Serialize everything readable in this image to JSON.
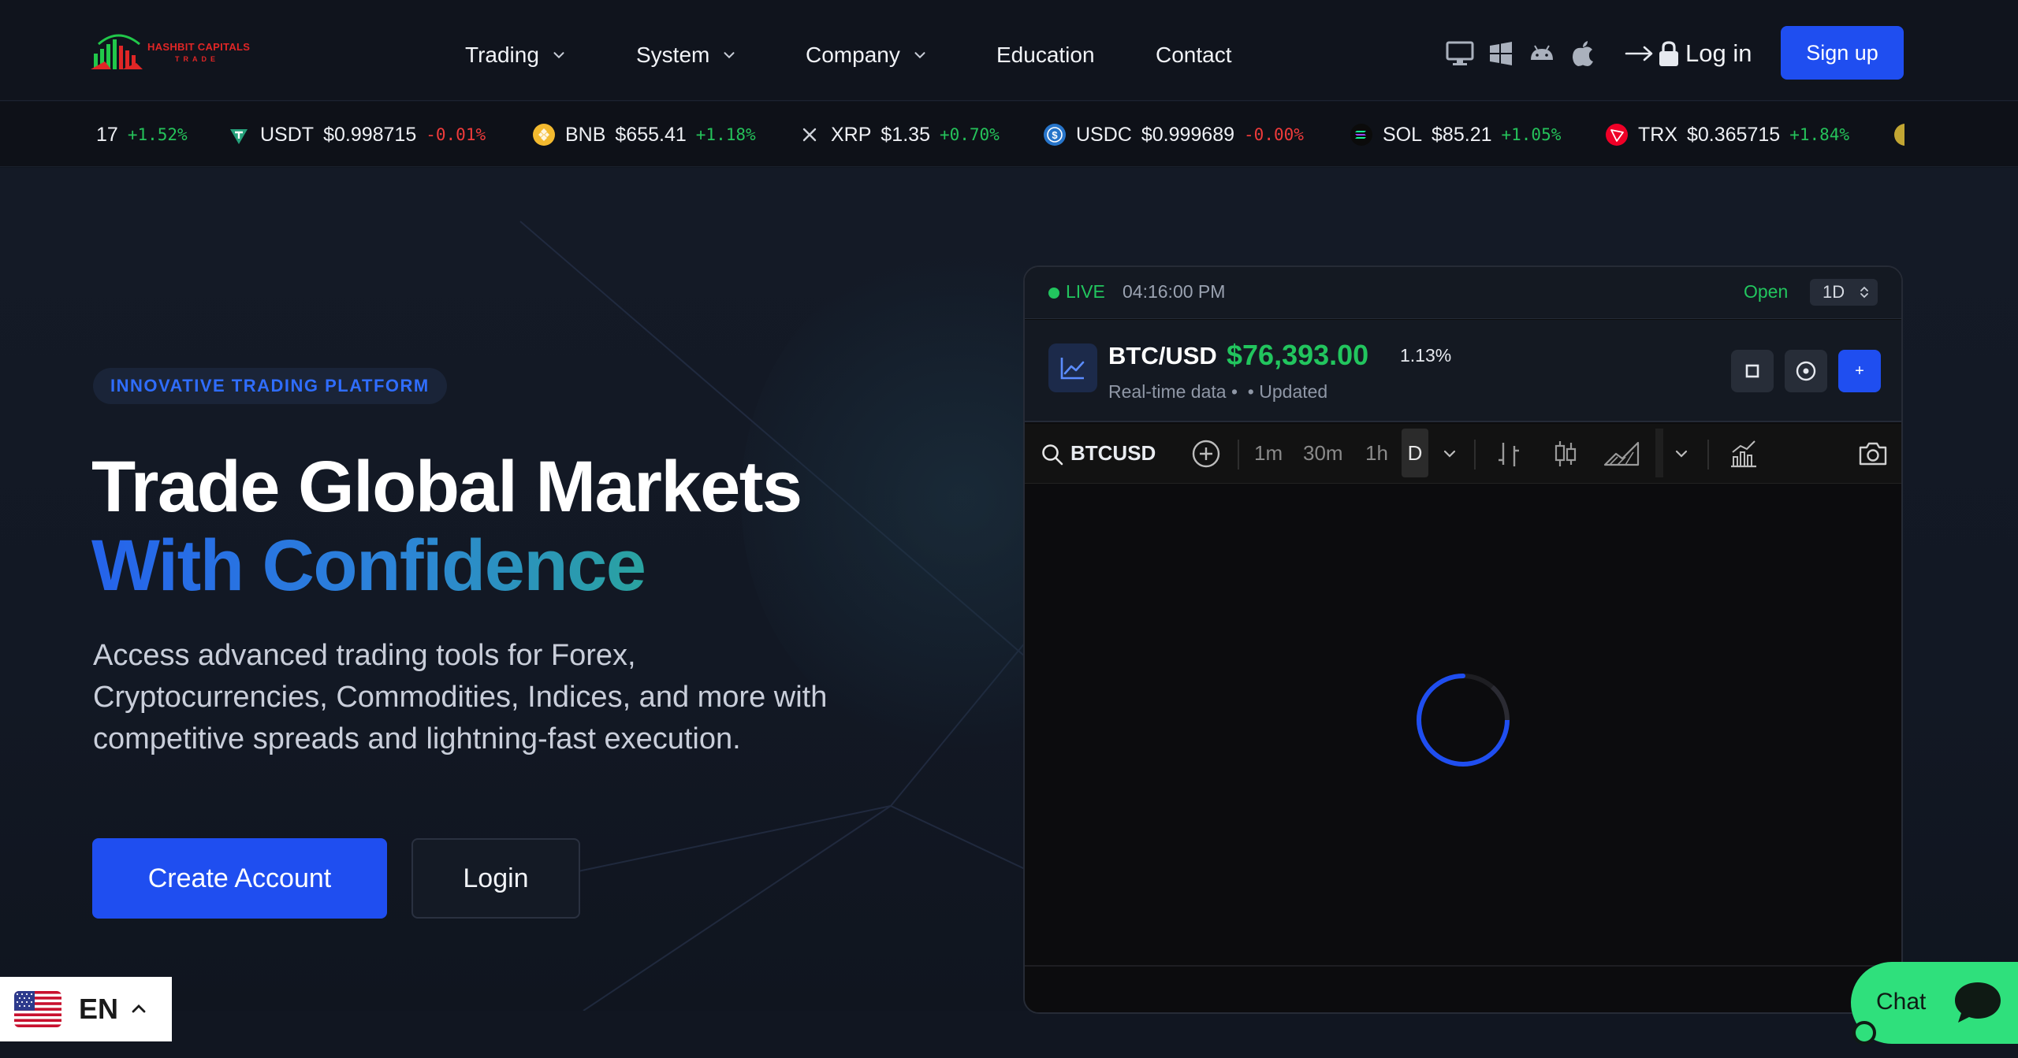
{
  "brand": {
    "name": "HASHBIT CAPITALS",
    "tagline": "TRADE",
    "logo_colors": [
      "#21c84a",
      "#e02626"
    ]
  },
  "nav": {
    "items": [
      {
        "label": "Trading",
        "has_menu": true
      },
      {
        "label": "System",
        "has_menu": true
      },
      {
        "label": "Company",
        "has_menu": true
      },
      {
        "label": "Education",
        "has_menu": false
      },
      {
        "label": "Contact",
        "has_menu": false
      }
    ],
    "platform_icons": [
      "desktop-icon",
      "windows-icon",
      "android-icon",
      "apple-icon"
    ],
    "login_label": "Log in",
    "signup_label": "Sign up"
  },
  "ticker": [
    {
      "symbol": "",
      "price": "17",
      "change": "+1.52%",
      "direction": "up",
      "icon": "partial"
    },
    {
      "symbol": "USDT",
      "price": "$0.998715",
      "change": "-0.01%",
      "direction": "down",
      "icon": "usdt-icon",
      "color": "#26a17b"
    },
    {
      "symbol": "BNB",
      "price": "$655.41",
      "change": "+1.18%",
      "direction": "up",
      "icon": "bnb-icon",
      "color": "#f3ba2f"
    },
    {
      "symbol": "XRP",
      "price": "$1.35",
      "change": "+0.70%",
      "direction": "up",
      "icon": "xrp-icon",
      "color": "#cfd3da"
    },
    {
      "symbol": "USDC",
      "price": "$0.999689",
      "change": "-0.00%",
      "direction": "down",
      "icon": "usdc-icon",
      "color": "#2775ca"
    },
    {
      "symbol": "SOL",
      "price": "$85.21",
      "change": "+1.05%",
      "direction": "up",
      "icon": "sol-icon",
      "color": "#14f195"
    },
    {
      "symbol": "TRX",
      "price": "$0.365715",
      "change": "+1.84%",
      "direction": "up",
      "icon": "trx-icon",
      "color": "#ef0027"
    }
  ],
  "hero": {
    "badge": "INNOVATIVE TRADING PLATFORM",
    "title_line1": "Trade Global Markets",
    "title_line2": "With Confidence",
    "lead": "Access advanced trading tools for Forex, Cryptocurrencies, Commodities, Indices, and more with competitive spreads and lightning-fast execution.",
    "primary_cta": "Create Account",
    "secondary_cta": "Login"
  },
  "widget": {
    "live_label": "LIVE",
    "time": "04:16:00 PM",
    "market_status": "Open",
    "timeframe": "1D",
    "pair": "BTC/USD",
    "price": "$76,393.00",
    "change_pct": "1.13%",
    "subtitle_left": "Real-time data",
    "subtitle_right": "Updated",
    "add_label": "+",
    "toolbar": {
      "symbol": "BTCUSD",
      "intervals": [
        "1m",
        "30m",
        "1h"
      ],
      "active_interval": "D"
    }
  },
  "language": {
    "code": "EN"
  },
  "chat": {
    "label": "Chat"
  },
  "colors": {
    "accent": "#1f4ef0",
    "positive": "#22c55e",
    "negative": "#ef3b3b",
    "chat": "#2fe07c"
  }
}
